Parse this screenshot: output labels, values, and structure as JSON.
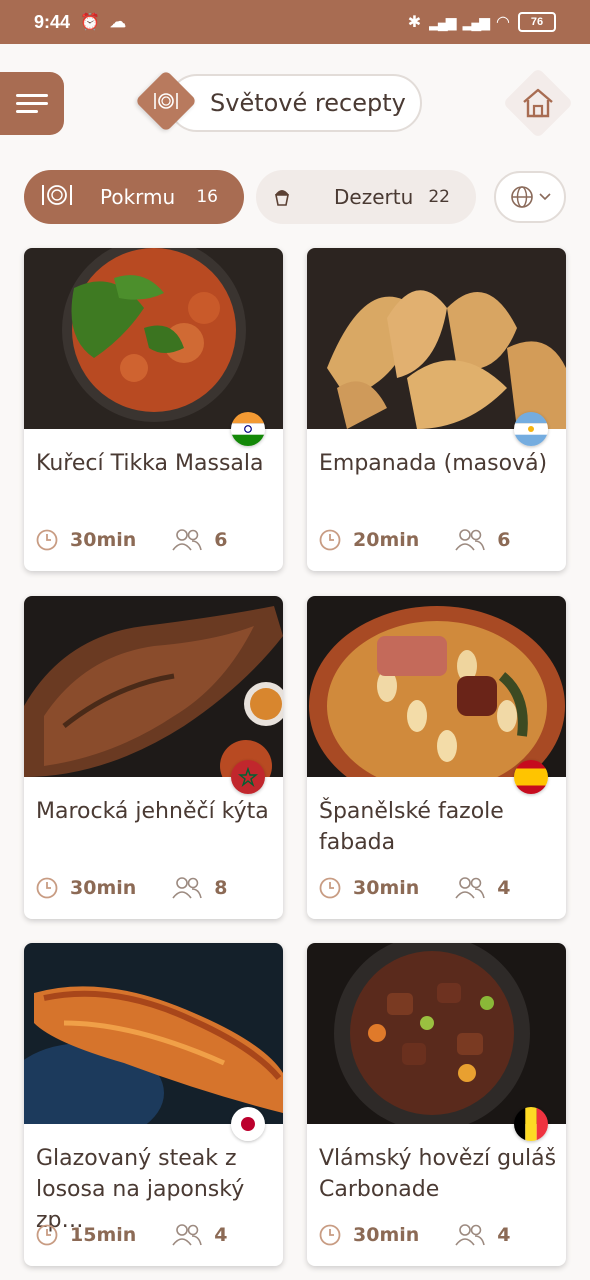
{
  "status_bar": {
    "time": "9:44",
    "battery": "76"
  },
  "header": {
    "title": "Světové recepty"
  },
  "tabs": [
    {
      "label": "Pokrmu",
      "count": "16"
    },
    {
      "label": "Dezertu",
      "count": "22"
    }
  ],
  "recipes": [
    {
      "name": "Kuřecí Tikka Massala",
      "time": "30min",
      "servings": "6",
      "flag": "india-flag-icon"
    },
    {
      "name": "Empanada (masová)",
      "time": "20min",
      "servings": "6",
      "flag": "argentina-flag-icon"
    },
    {
      "name": "Marocká jehněčí kýta",
      "time": "30min",
      "servings": "8",
      "flag": "morocco-flag-icon"
    },
    {
      "name": "Španělské fazole fabada",
      "time": "30min",
      "servings": "4",
      "flag": "spain-flag-icon"
    },
    {
      "name": "Glazovaný steak z lososa na japonský zp…",
      "time": "15min",
      "servings": "4",
      "flag": "japan-flag-icon"
    },
    {
      "name": "Vlámský hovězí guláš Carbonade",
      "time": "30min",
      "servings": "4",
      "flag": "belgium-flag-icon"
    }
  ],
  "colors": {
    "accent": "#a86c52",
    "tab_inactive": "#f1ebe8",
    "meta_text": "#8c6a55"
  }
}
